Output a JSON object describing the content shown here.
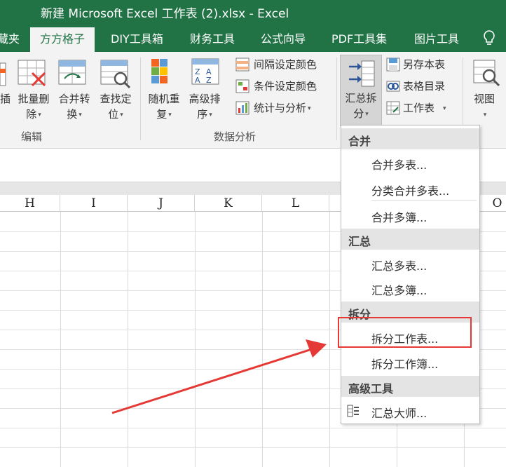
{
  "window": {
    "title": "新建 Microsoft Excel 工作表 (2).xlsx - Excel"
  },
  "tabs": [
    {
      "label": "藏夹"
    },
    {
      "label": "方方格子",
      "active": true
    },
    {
      "label": "DIY工具箱"
    },
    {
      "label": "财务工具"
    },
    {
      "label": "公式向导"
    },
    {
      "label": "PDF工具集"
    },
    {
      "label": "图片工具"
    }
  ],
  "ribbon": {
    "edit_group": {
      "label": "编辑",
      "insert_partial": "插",
      "batch_delete": [
        "批量删",
        "除"
      ],
      "merge_convert": [
        "合并转",
        "换"
      ],
      "find_locate": [
        "查找定",
        "位"
      ]
    },
    "data_group": {
      "label": "数据分析",
      "random_repeat": [
        "随机重",
        "复"
      ],
      "advanced_sort": [
        "高级排",
        "序"
      ],
      "interval_color": "间隔设定颜色",
      "conditional_color": "条件设定颜色",
      "stats_analysis": "统计与分析"
    },
    "summary_split": [
      "汇总拆",
      "分"
    ],
    "save_table": "另存本表",
    "table_directory": "表格目录",
    "worksheet": "工作表",
    "view": "视图"
  },
  "columns": [
    "H",
    "I",
    "J",
    "K",
    "L",
    "O"
  ],
  "menu": {
    "sections": [
      {
        "header": "合并",
        "items": [
          "合并多表...",
          "分类合并多表...",
          "合并多簿..."
        ]
      },
      {
        "header": "汇总",
        "items": [
          "汇总多表...",
          "汇总多簿..."
        ]
      },
      {
        "header": "拆分",
        "items": [
          "拆分工作表...",
          "拆分工作簿..."
        ]
      },
      {
        "header": "高级工具",
        "items": [
          "汇总大师..."
        ]
      }
    ]
  },
  "colors": {
    "excel_green": "#217346",
    "annotation_red": "#e53935"
  }
}
